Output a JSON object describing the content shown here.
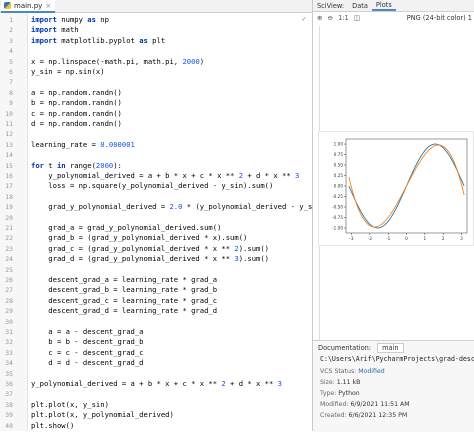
{
  "editor": {
    "tab_label": "main.py",
    "lines": [
      [
        [
          "kw",
          "import"
        ],
        [
          "t",
          " numpy "
        ],
        [
          "kw",
          "as"
        ],
        [
          "t",
          " np"
        ]
      ],
      [
        [
          "kw",
          "import"
        ],
        [
          "t",
          " math"
        ]
      ],
      [
        [
          "kw",
          "import"
        ],
        [
          "t",
          " matplotlib.pyplot "
        ],
        [
          "kw",
          "as"
        ],
        [
          "t",
          " plt"
        ]
      ],
      [],
      [
        [
          "t",
          "x = np.linspace(-math.pi, math.pi, "
        ],
        [
          "num",
          "2000"
        ],
        [
          "t",
          ")"
        ]
      ],
      [
        [
          "t",
          "y_sin = np.sin(x)"
        ]
      ],
      [],
      [
        [
          "t",
          "a = np.random.randn()"
        ]
      ],
      [
        [
          "t",
          "b = np.random.randn()"
        ]
      ],
      [
        [
          "t",
          "c = np.random.randn()"
        ]
      ],
      [
        [
          "t",
          "d = np.random.randn()"
        ]
      ],
      [],
      [
        [
          "t",
          "learning_rate = "
        ],
        [
          "num",
          "0.000001"
        ]
      ],
      [],
      [
        [
          "kw",
          "for"
        ],
        [
          "t",
          " t "
        ],
        [
          "kw",
          "in"
        ],
        [
          "t",
          " range("
        ],
        [
          "num",
          "2000"
        ],
        [
          "t",
          "):"
        ]
      ],
      [
        [
          "t",
          "    y_polynomial_derived = a + b * x + c * x ** "
        ],
        [
          "num",
          "2"
        ],
        [
          "t",
          " + d * x ** "
        ],
        [
          "num",
          "3"
        ]
      ],
      [
        [
          "t",
          "    loss = np.square(y_polynomial_derived - y_sin).sum()"
        ]
      ],
      [],
      [
        [
          "t",
          "    grad_y_polynomial_derived = "
        ],
        [
          "num",
          "2.0"
        ],
        [
          "t",
          " * (y_polynomial_derived - y_sin)"
        ]
      ],
      [],
      [
        [
          "t",
          "    grad_a = grad_y_polynomial_derived.sum()"
        ]
      ],
      [
        [
          "t",
          "    grad_b = (grad_y_polynomial_derived * x).sum()"
        ]
      ],
      [
        [
          "t",
          "    grad_c = (grad_y_polynomial_derived * x ** "
        ],
        [
          "num",
          "2"
        ],
        [
          "t",
          ").sum()"
        ]
      ],
      [
        [
          "t",
          "    grad_d = (grad_y_polynomial_derived * x ** "
        ],
        [
          "num",
          "3"
        ],
        [
          "t",
          ").sum()"
        ]
      ],
      [],
      [
        [
          "t",
          "    descent_grad_a = learning_rate * grad_a"
        ]
      ],
      [
        [
          "t",
          "    descent_grad_b = learning_rate * grad_b"
        ]
      ],
      [
        [
          "t",
          "    descent_grad_c = learning_rate * grad_c"
        ]
      ],
      [
        [
          "t",
          "    descent_grad_d = learning_rate * grad_d"
        ]
      ],
      [],
      [
        [
          "t",
          "    a = a - descent_grad_a"
        ]
      ],
      [
        [
          "t",
          "    b = b - descent_grad_b"
        ]
      ],
      [
        [
          "t",
          "    c = c - descent_grad_c"
        ]
      ],
      [
        [
          "t",
          "    d = d - descent_grad_d"
        ]
      ],
      [],
      [
        [
          "t",
          "y_polynomial_derived = a + b * x + c * x ** "
        ],
        [
          "num",
          "2"
        ],
        [
          "t",
          " + d * x ** "
        ],
        [
          "num",
          "3"
        ]
      ],
      [],
      [
        [
          "t",
          "plt.plot(x, y_sin)"
        ]
      ],
      [
        [
          "t",
          "plt.plot(x, y_polynomial_derived)"
        ]
      ],
      [
        [
          "t",
          "plt.show()"
        ]
      ]
    ]
  },
  "sciview": {
    "title": "SciView:",
    "tabs": [
      "Data",
      "Plots"
    ],
    "active_tab": "Plots",
    "zoom_label": "1:1",
    "format_label": "PNG (24-bit color) 1"
  },
  "chart_data": {
    "type": "line",
    "x_ticks": [
      "-3",
      "-2",
      "-1",
      "0",
      "1",
      "2",
      "3"
    ],
    "y_ticks": [
      "1.00",
      "0.75",
      "0.50",
      "0.25",
      "0.00",
      "-0.25",
      "-0.50",
      "-0.75",
      "-1.00"
    ],
    "xlim": [
      -3.3,
      3.3
    ],
    "ylim": [
      -1.12,
      1.12
    ],
    "series": [
      {
        "color": "#1f77b4",
        "function": "sin"
      },
      {
        "color": "#ff7f0e",
        "coeffs": [
          0.0,
          0.84,
          0.0,
          -0.092
        ]
      }
    ]
  },
  "documentation": {
    "label": "Documentation:",
    "tab": "main",
    "path": "C:\\Users\\Arif\\PycharmProjects\\grad-desc\\ma",
    "vcs_label": "VCS Status:",
    "vcs_value": "Modified",
    "size_label": "Size:",
    "size_value": "1.11 kB",
    "type_label": "Type:",
    "type_value": "Python",
    "modified_label": "Modified:",
    "modified_value": "6/9/2021 11:51 AM",
    "created_label": "Created:",
    "created_value": "6/6/2021 12:35 PM"
  },
  "colors": {
    "keyword": "#0033b3",
    "number": "#1750eb",
    "accent": "#4a88c7"
  }
}
